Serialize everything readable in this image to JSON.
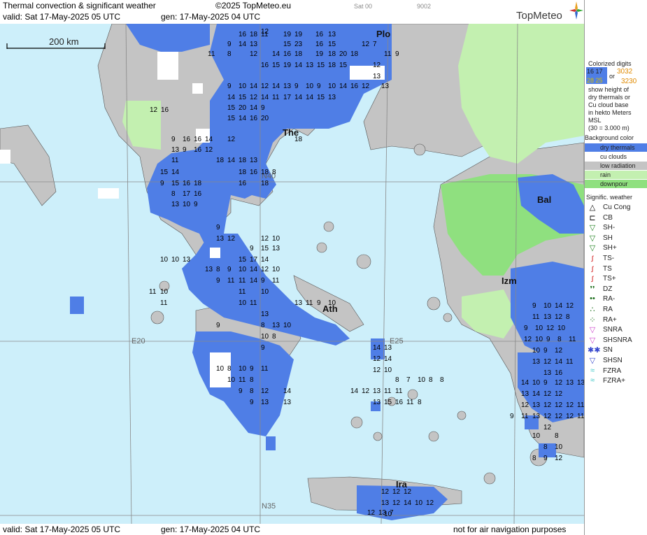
{
  "header": {
    "title": "Thermal convection & significant weather",
    "copyright": "©2025 TopMeteo.eu",
    "valid": "valid:  Sat  17-May-2025  05 UTC",
    "gen": "gen: 17-May-2025 04 UTC",
    "aux1": "Sat 00",
    "aux2": "9002",
    "logo": "TopMeteo"
  },
  "footer": {
    "valid": "valid:  Sat  17-May-2025  05 UTC",
    "gen": "gen: 17-May-2025 04 UTC",
    "disclaimer": "not for air navigation purposes"
  },
  "scale_bar": "200 km",
  "grid_labels": [
    "N40",
    "E20",
    "E25",
    "N35"
  ],
  "cities": [
    {
      "id": "plo",
      "label": "Plo"
    },
    {
      "id": "the",
      "label": "The"
    },
    {
      "id": "bal",
      "label": "Bal"
    },
    {
      "id": "izm",
      "label": "Izm"
    },
    {
      "id": "ath",
      "label": "Ath"
    },
    {
      "id": "ira",
      "label": "Ira"
    }
  ],
  "cloud_numbers": [
    {
      "v": "12"
    },
    {
      "v": "16"
    },
    {
      "v": "18"
    },
    {
      "v": "11"
    },
    {
      "v": "19"
    },
    {
      "v": "19"
    },
    {
      "v": "16"
    },
    {
      "v": "13"
    },
    {
      "v": "9"
    },
    {
      "v": "14"
    },
    {
      "v": "13"
    },
    {
      "v": "15"
    },
    {
      "v": "23"
    },
    {
      "v": "16"
    },
    {
      "v": "15"
    },
    {
      "v": "12"
    },
    {
      "v": "7"
    },
    {
      "v": "11"
    },
    {
      "v": "8"
    },
    {
      "v": "12"
    },
    {
      "v": "14"
    },
    {
      "v": "16"
    },
    {
      "v": "18"
    },
    {
      "v": "19"
    },
    {
      "v": "18"
    },
    {
      "v": "20"
    },
    {
      "v": "18"
    },
    {
      "v": "11"
    },
    {
      "v": "9"
    },
    {
      "v": "16"
    },
    {
      "v": "15"
    },
    {
      "v": "19"
    },
    {
      "v": "14"
    },
    {
      "v": "13"
    },
    {
      "v": "15"
    },
    {
      "v": "18"
    },
    {
      "v": "15"
    },
    {
      "v": "12"
    },
    {
      "v": "9"
    },
    {
      "v": "10"
    },
    {
      "v": "14"
    },
    {
      "v": "12"
    },
    {
      "v": "14"
    },
    {
      "v": "13"
    },
    {
      "v": "9"
    },
    {
      "v": "10"
    },
    {
      "v": "9"
    },
    {
      "v": "10"
    },
    {
      "v": "14"
    },
    {
      "v": "16"
    },
    {
      "v": "12"
    },
    {
      "v": "13"
    },
    {
      "v": "13"
    },
    {
      "v": "14"
    },
    {
      "v": "15"
    },
    {
      "v": "12"
    },
    {
      "v": "14"
    },
    {
      "v": "11"
    },
    {
      "v": "17"
    },
    {
      "v": "14"
    },
    {
      "v": "14"
    },
    {
      "v": "15"
    },
    {
      "v": "13"
    },
    {
      "v": "15"
    },
    {
      "v": "20"
    },
    {
      "v": "14"
    },
    {
      "v": "9"
    },
    {
      "v": "12"
    },
    {
      "v": "16"
    },
    {
      "v": "15"
    },
    {
      "v": "14"
    },
    {
      "v": "16"
    },
    {
      "v": "20"
    },
    {
      "v": "9"
    },
    {
      "v": "16"
    },
    {
      "v": "16"
    },
    {
      "v": "14"
    },
    {
      "v": "12"
    },
    {
      "v": "18"
    },
    {
      "v": "13"
    },
    {
      "v": "9"
    },
    {
      "v": "16"
    },
    {
      "v": "12"
    },
    {
      "v": "11"
    },
    {
      "v": "18"
    },
    {
      "v": "14"
    },
    {
      "v": "18"
    },
    {
      "v": "13"
    },
    {
      "v": "15"
    },
    {
      "v": "14"
    },
    {
      "v": "18"
    },
    {
      "v": "16"
    },
    {
      "v": "18"
    },
    {
      "v": "8"
    },
    {
      "v": "9"
    },
    {
      "v": "15"
    },
    {
      "v": "16"
    },
    {
      "v": "18"
    },
    {
      "v": "16"
    },
    {
      "v": "18"
    },
    {
      "v": "8"
    },
    {
      "v": "17"
    },
    {
      "v": "16"
    },
    {
      "v": "13"
    },
    {
      "v": "10"
    },
    {
      "v": "9"
    },
    {
      "v": "9"
    },
    {
      "v": "13"
    },
    {
      "v": "12"
    },
    {
      "v": "12"
    },
    {
      "v": "10"
    },
    {
      "v": "9"
    },
    {
      "v": "15"
    },
    {
      "v": "13"
    },
    {
      "v": "10"
    },
    {
      "v": "10"
    },
    {
      "v": "13"
    },
    {
      "v": "15"
    },
    {
      "v": "17"
    },
    {
      "v": "14"
    },
    {
      "v": "13"
    },
    {
      "v": "8"
    },
    {
      "v": "9"
    },
    {
      "v": "10"
    },
    {
      "v": "14"
    },
    {
      "v": "12"
    },
    {
      "v": "10"
    },
    {
      "v": "9"
    },
    {
      "v": "11"
    },
    {
      "v": "11"
    },
    {
      "v": "14"
    },
    {
      "v": "9"
    },
    {
      "v": "11"
    },
    {
      "v": "11"
    },
    {
      "v": "10"
    },
    {
      "v": "11"
    },
    {
      "v": "10"
    },
    {
      "v": "11"
    },
    {
      "v": "10"
    },
    {
      "v": "11"
    },
    {
      "v": "13"
    },
    {
      "v": "11"
    },
    {
      "v": "9"
    },
    {
      "v": "10"
    },
    {
      "v": "13"
    },
    {
      "v": "8"
    },
    {
      "v": "13"
    },
    {
      "v": "10"
    },
    {
      "v": "9"
    },
    {
      "v": "10"
    },
    {
      "v": "8"
    },
    {
      "v": "10"
    },
    {
      "v": "8"
    },
    {
      "v": "10"
    },
    {
      "v": "9"
    },
    {
      "v": "11"
    },
    {
      "v": "9"
    },
    {
      "v": "10"
    },
    {
      "v": "11"
    },
    {
      "v": "8"
    },
    {
      "v": "9"
    },
    {
      "v": "8"
    },
    {
      "v": "12"
    },
    {
      "v": "9"
    },
    {
      "v": "13"
    },
    {
      "v": "14"
    },
    {
      "v": "13"
    },
    {
      "v": "14"
    },
    {
      "v": "13"
    },
    {
      "v": "12"
    },
    {
      "v": "14"
    },
    {
      "v": "12"
    },
    {
      "v": "10"
    },
    {
      "v": "8"
    },
    {
      "v": "7"
    },
    {
      "v": "10"
    },
    {
      "v": "8"
    },
    {
      "v": "8"
    },
    {
      "v": "14"
    },
    {
      "v": "12"
    },
    {
      "v": "13"
    },
    {
      "v": "11"
    },
    {
      "v": "11"
    },
    {
      "v": "13"
    },
    {
      "v": "15"
    },
    {
      "v": "16"
    },
    {
      "v": "11"
    },
    {
      "v": "8"
    },
    {
      "v": "9"
    },
    {
      "v": "10"
    },
    {
      "v": "14"
    },
    {
      "v": "12"
    },
    {
      "v": "11"
    },
    {
      "v": "13"
    },
    {
      "v": "12"
    },
    {
      "v": "8"
    },
    {
      "v": "9"
    },
    {
      "v": "10"
    },
    {
      "v": "12"
    },
    {
      "v": "10"
    },
    {
      "v": "12"
    },
    {
      "v": "10"
    },
    {
      "v": "9"
    },
    {
      "v": "8"
    },
    {
      "v": "11"
    },
    {
      "v": "10"
    },
    {
      "v": "9"
    },
    {
      "v": "12"
    },
    {
      "v": "13"
    },
    {
      "v": "12"
    },
    {
      "v": "14"
    },
    {
      "v": "11"
    },
    {
      "v": "13"
    },
    {
      "v": "16"
    },
    {
      "v": "14"
    },
    {
      "v": "10"
    },
    {
      "v": "9"
    },
    {
      "v": "12"
    },
    {
      "v": "13"
    },
    {
      "v": "13"
    },
    {
      "v": "13"
    },
    {
      "v": "14"
    },
    {
      "v": "12"
    },
    {
      "v": "12"
    },
    {
      "v": "13"
    },
    {
      "v": "12"
    },
    {
      "v": "12"
    },
    {
      "v": "12"
    },
    {
      "v": "11"
    },
    {
      "v": "12"
    },
    {
      "v": "13"
    },
    {
      "v": "12"
    },
    {
      "v": "12"
    },
    {
      "v": "12"
    },
    {
      "v": "11"
    },
    {
      "v": "11"
    },
    {
      "v": "9"
    },
    {
      "v": "12"
    },
    {
      "v": "10"
    },
    {
      "v": "8"
    },
    {
      "v": "8"
    },
    {
      "v": "10"
    },
    {
      "v": "8"
    },
    {
      "v": "9"
    },
    {
      "v": "12"
    },
    {
      "v": "12"
    },
    {
      "v": "12"
    },
    {
      "v": "12"
    },
    {
      "v": "13"
    },
    {
      "v": "12"
    },
    {
      "v": "14"
    },
    {
      "v": "10"
    },
    {
      "v": "12"
    },
    {
      "v": "12"
    },
    {
      "v": "13"
    },
    {
      "v": "7"
    },
    {
      "v": "10"
    }
  ],
  "legend": {
    "colorized_title": "Colorized digits",
    "sample_a1": "16 17",
    "sample_a2": "28 25",
    "or": "or",
    "sample_b1": "3032",
    "sample_b2": "3230",
    "desc": [
      "show height of",
      "dry thermals or",
      "Cu cloud base",
      "in hekto Meters",
      "MSL",
      "(30 = 3.000 m)"
    ],
    "bg_title": "Background color",
    "bg_items": [
      {
        "label": "dry thermals",
        "color": "#4f7ee6"
      },
      {
        "label": "cu clouds",
        "color": "#ffffff"
      },
      {
        "label": "low radiation",
        "color": "#c4c4c4"
      },
      {
        "label": "rain",
        "color": "#c3f0b0"
      },
      {
        "label": "downpour",
        "color": "#8fe07f"
      }
    ],
    "weather_title": "Signific. weather",
    "weather_items": [
      {
        "sym": "△",
        "label": "Cu Cong",
        "color": "#000000"
      },
      {
        "sym": "⊏",
        "label": "CB",
        "color": "#000000"
      },
      {
        "sym": "▽",
        "label": "SH-",
        "color": "#1b7d1b"
      },
      {
        "sym": "▽",
        "label": "SH",
        "color": "#1b7d1b"
      },
      {
        "sym": "▽",
        "label": "SH+",
        "color": "#1b7d1b"
      },
      {
        "sym": "ꭍ",
        "label": "TS-",
        "color": "#d42020"
      },
      {
        "sym": "ꭍ",
        "label": "TS",
        "color": "#d42020"
      },
      {
        "sym": "ꭍ",
        "label": "TS+",
        "color": "#d42020"
      },
      {
        "sym": "❜❜",
        "label": "DZ",
        "color": "#1b6e1b"
      },
      {
        "sym": "••",
        "label": "RA-",
        "color": "#1b6e1b"
      },
      {
        "sym": "∴",
        "label": "RA",
        "color": "#1b6e1b"
      },
      {
        "sym": "⁘",
        "label": "RA+",
        "color": "#1b6e1b"
      },
      {
        "sym": "▽",
        "label": "SNRA",
        "color": "#cc44cc"
      },
      {
        "sym": "▽",
        "label": "SHSNRA",
        "color": "#cc44cc"
      },
      {
        "sym": "✱✱",
        "label": "SN",
        "color": "#3344cc"
      },
      {
        "sym": "▽",
        "label": "SHSN",
        "color": "#3344cc"
      },
      {
        "sym": "≈",
        "label": "FZRA",
        "color": "#33c4c4"
      },
      {
        "sym": "≈",
        "label": "FZRA+",
        "color": "#33c4c4"
      }
    ]
  }
}
